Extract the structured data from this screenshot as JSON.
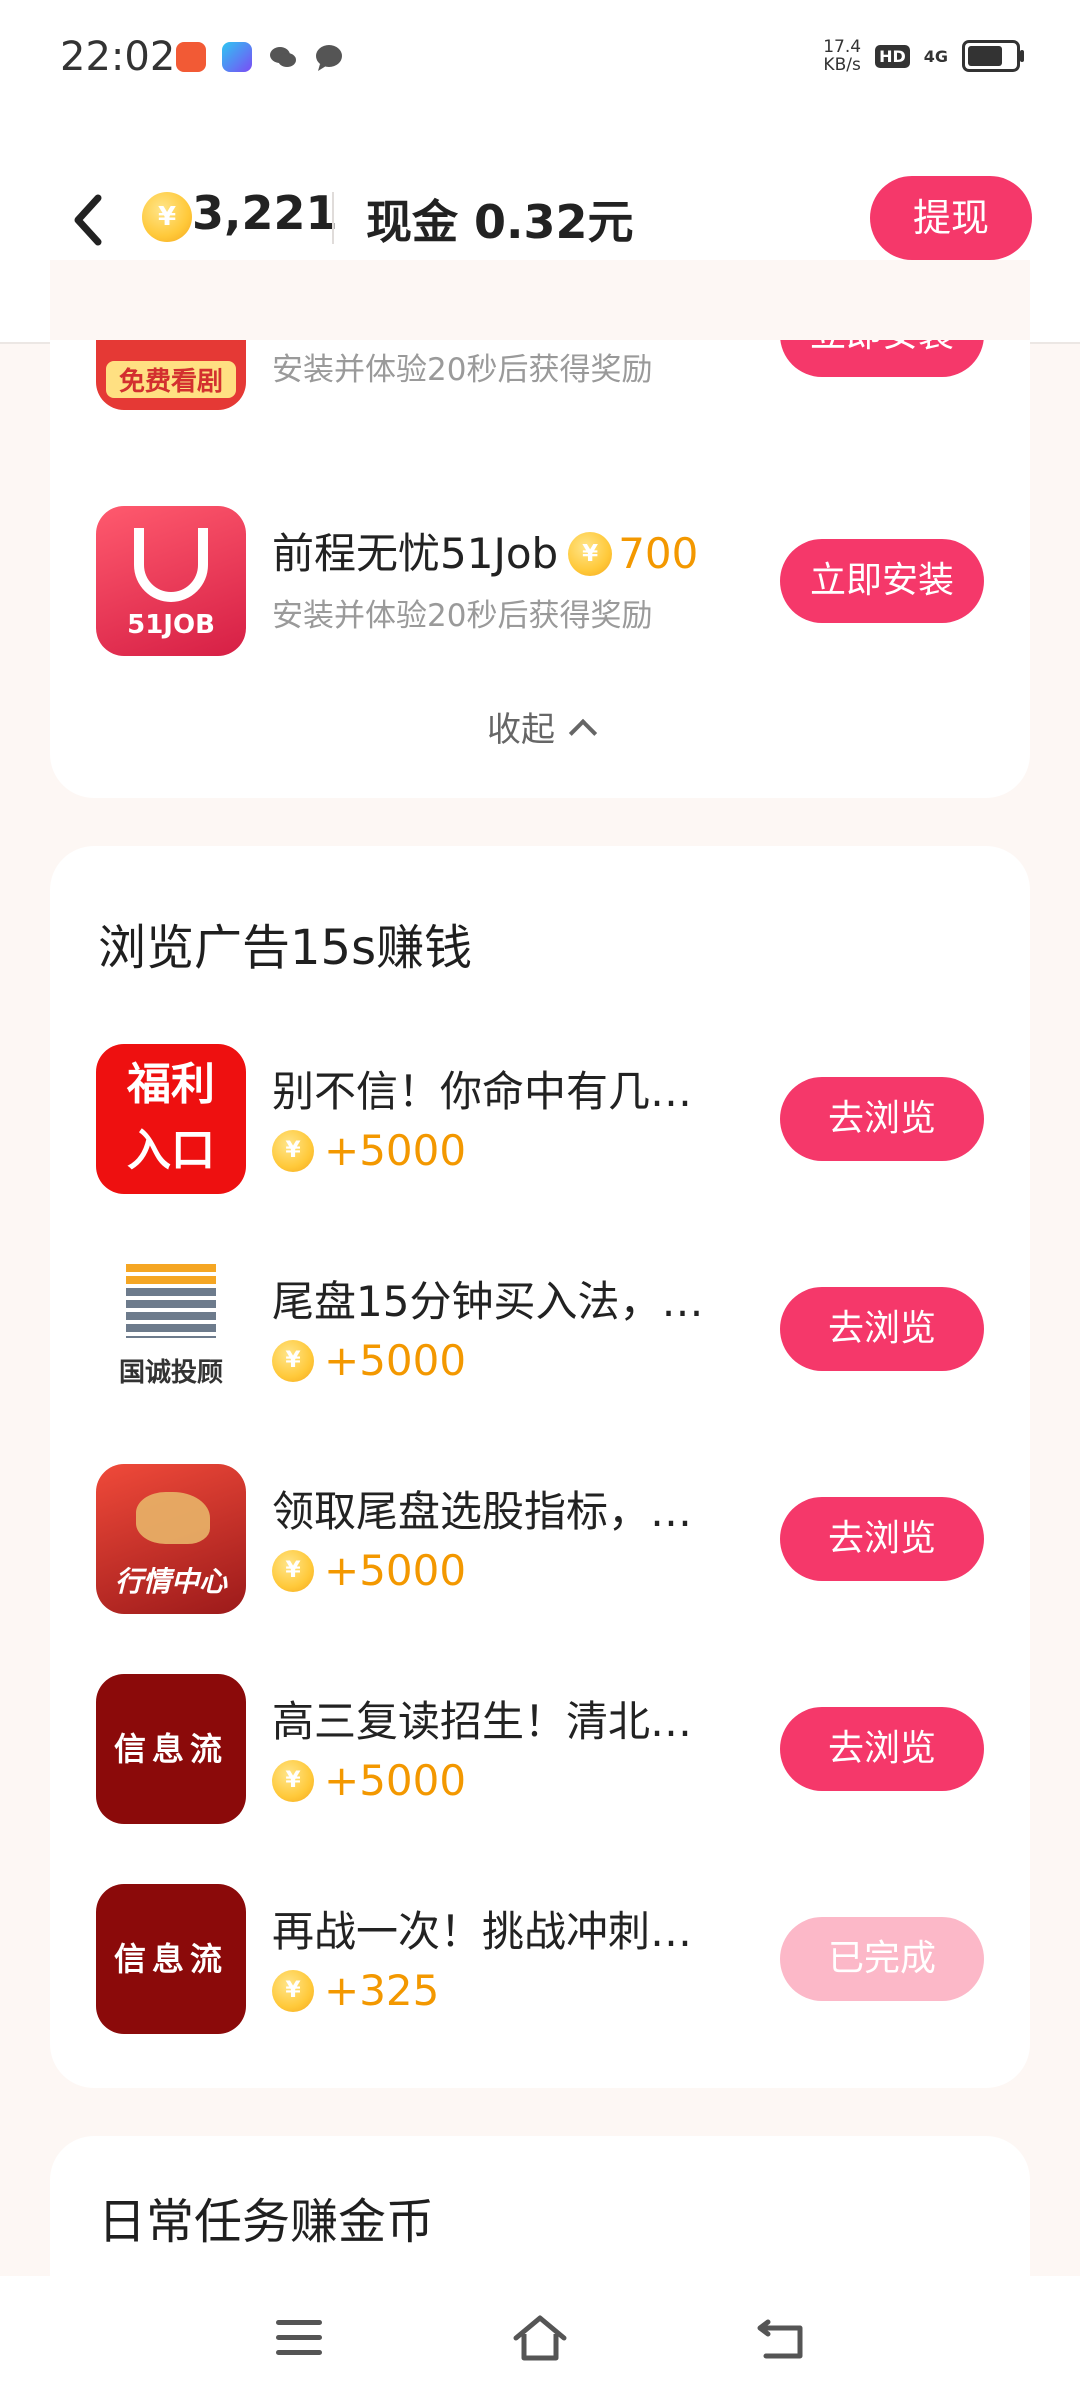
{
  "status_bar": {
    "time": "22:02",
    "speed_value": "17.4",
    "speed_unit": "KB/s",
    "hd": "HD",
    "network": "4G"
  },
  "header": {
    "coins": "3,221",
    "cash": "现金 0.32元",
    "withdraw_label": "提现"
  },
  "install_section": {
    "partial_row": {
      "icon_text": "免费看剧",
      "subtitle": "安装并体验20秒后获得奖励",
      "button": "立即安装"
    },
    "rows": [
      {
        "title": "前程无忧51Job",
        "reward": "700",
        "subtitle": "安装并体验20秒后获得奖励",
        "button": "立即安装",
        "icon_text": "51JOB"
      }
    ],
    "collapse_label": "收起"
  },
  "browse_section": {
    "title": "浏览广告15s赚钱",
    "rows": [
      {
        "title": "别不信！你命中有几…",
        "reward": "+5000",
        "button": "去浏览",
        "icon_line1": "福利",
        "icon_line2": "入口"
      },
      {
        "title": "尾盘15分钟买入法，…",
        "reward": "+5000",
        "button": "去浏览",
        "icon_text": "国诚投顾"
      },
      {
        "title": "领取尾盘选股指标，…",
        "reward": "+5000",
        "button": "去浏览",
        "icon_text": "行情中心"
      },
      {
        "title": "高三复读招生！清北…",
        "reward": "+5000",
        "button": "去浏览",
        "icon_text": "信息流"
      },
      {
        "title": "再战一次！挑战冲刺…",
        "reward": "+325",
        "button": "已完成",
        "icon_text": "信息流"
      }
    ]
  },
  "daily_section": {
    "title": "日常任务赚金币"
  },
  "colors": {
    "accent": "#f5386a",
    "done": "#fcb8c8",
    "reward": "#f39800"
  }
}
